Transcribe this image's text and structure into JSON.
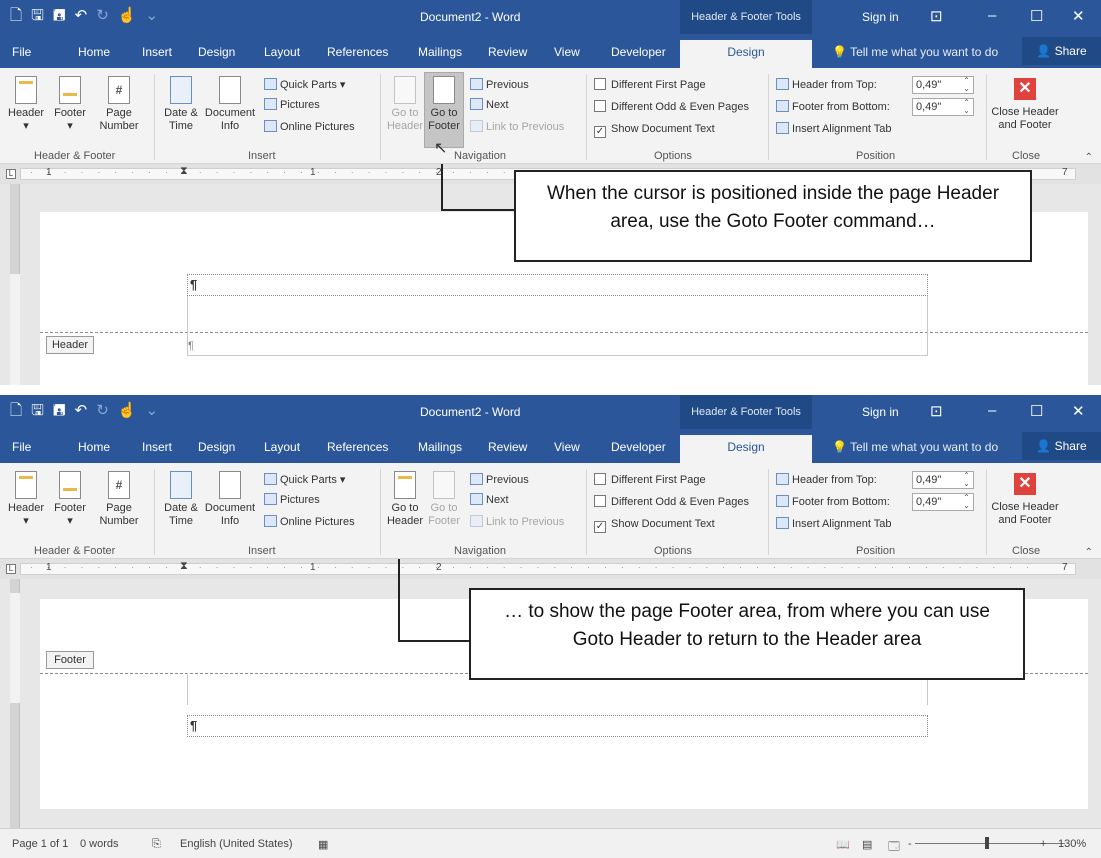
{
  "title_bar": {
    "doc_title": "Document2  -  Word",
    "contextual_group": "Header & Footer Tools",
    "sign_in": "Sign in",
    "qat_icons": [
      "new-doc-icon",
      "save-icon",
      "save-as-icon",
      "undo-icon",
      "redo-icon",
      "touch-mode-icon",
      "customize-icon"
    ]
  },
  "tabs": {
    "file": "File",
    "home": "Home",
    "insert": "Insert",
    "design": "Design",
    "layout": "Layout",
    "references": "References",
    "mailings": "Mailings",
    "review": "Review",
    "view": "View",
    "developer": "Developer",
    "hf_design": "Design",
    "tell_me": "Tell me what you want to do",
    "share": "Share"
  },
  "ribbon": {
    "header_footer": {
      "header": "Header",
      "footer": "Footer",
      "page": "Page",
      "number": "Number",
      "group": "Header & Footer"
    },
    "insert": {
      "date": "Date &",
      "time": "Time",
      "document": "Document",
      "info": "Info",
      "quick_parts": "Quick Parts",
      "pictures": "Pictures",
      "online_pictures": "Online Pictures",
      "group": "Insert"
    },
    "navigation": {
      "go_to": "Go to",
      "header": "Header",
      "footer": "Footer",
      "previous": "Previous",
      "next": "Next",
      "link_to_previous": "Link to Previous",
      "group": "Navigation"
    },
    "options": {
      "different_first_page": "Different First Page",
      "different_odd_even": "Different Odd & Even Pages",
      "show_document_text": "Show Document Text",
      "group": "Options"
    },
    "position": {
      "header_from_top": "Header from Top:",
      "footer_from_bottom": "Footer from Bottom:",
      "header_value": "0,49\"",
      "footer_value": "0,49\"",
      "insert_alignment_tab": "Insert Alignment Tab",
      "group": "Position"
    },
    "close": {
      "close_header": "Close Header",
      "and_footer": "and Footer",
      "group": "Close"
    }
  },
  "ruler": {
    "tab_selector": "L",
    "numbers": [
      "1",
      "1",
      "2",
      "7"
    ]
  },
  "document": {
    "pilcrow": "¶",
    "header_label": "Header",
    "footer_label": "Footer"
  },
  "callouts": {
    "top": "When the cursor is positioned inside the page Header area, use the Goto Footer command…",
    "bottom": "… to show the page Footer area, from where you can use Goto Header to return to the Header area"
  },
  "status_bar": {
    "page": "Page 1 of 1",
    "words": "0 words",
    "language": "English (United States)",
    "zoom": "130%",
    "zoom_minus": "-",
    "zoom_plus": "+"
  }
}
